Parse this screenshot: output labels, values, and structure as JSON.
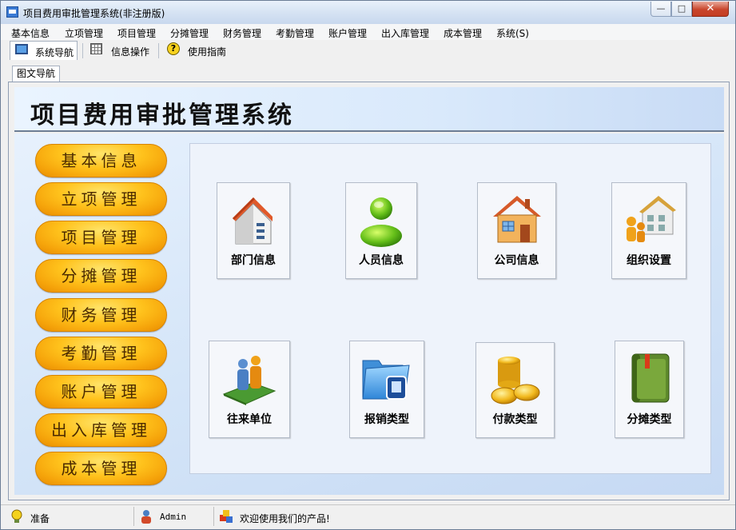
{
  "window": {
    "title": "项目费用审批管理系统(非注册版)",
    "controls": [
      "minimize",
      "maximize",
      "close"
    ]
  },
  "menu": [
    "基本信息",
    "立项管理",
    "项目管理",
    "分摊管理",
    "财务管理",
    "考勤管理",
    "账户管理",
    "出入库管理",
    "成本管理",
    "系统(S)"
  ],
  "toolbar": [
    {
      "label": "系统导航",
      "icon": "monitor-icon",
      "active": true
    },
    {
      "label": "信息操作",
      "icon": "grid-icon",
      "active": false
    },
    {
      "label": "使用指南",
      "icon": "help-icon",
      "active": false
    }
  ],
  "doc_tab": "图文导航",
  "header": {
    "title": "项目费用审批管理系统"
  },
  "nav_buttons": [
    "基本信息",
    "立项管理",
    "项目管理",
    "分摊管理",
    "财务管理",
    "考勤管理",
    "账户管理",
    "出入库管理",
    "成本管理"
  ],
  "cards": [
    {
      "label": "部门信息",
      "icon": "department-icon"
    },
    {
      "label": "人员信息",
      "icon": "person-icon"
    },
    {
      "label": "公司信息",
      "icon": "house-icon"
    },
    {
      "label": "组织设置",
      "icon": "organization-icon"
    },
    {
      "label": "往来单位",
      "icon": "partners-icon"
    },
    {
      "label": "报销类型",
      "icon": "folder-icon"
    },
    {
      "label": "付款类型",
      "icon": "coins-icon"
    },
    {
      "label": "分摊类型",
      "icon": "book-icon"
    }
  ],
  "status": {
    "state": "准备",
    "user": "Admin",
    "message": "欢迎使用我们的产品!"
  },
  "colors": {
    "pill_top": "#ffe46a",
    "pill_bottom": "#e88c00",
    "panel_bg": "#d9e9fb",
    "close_button": "#c9462c"
  }
}
